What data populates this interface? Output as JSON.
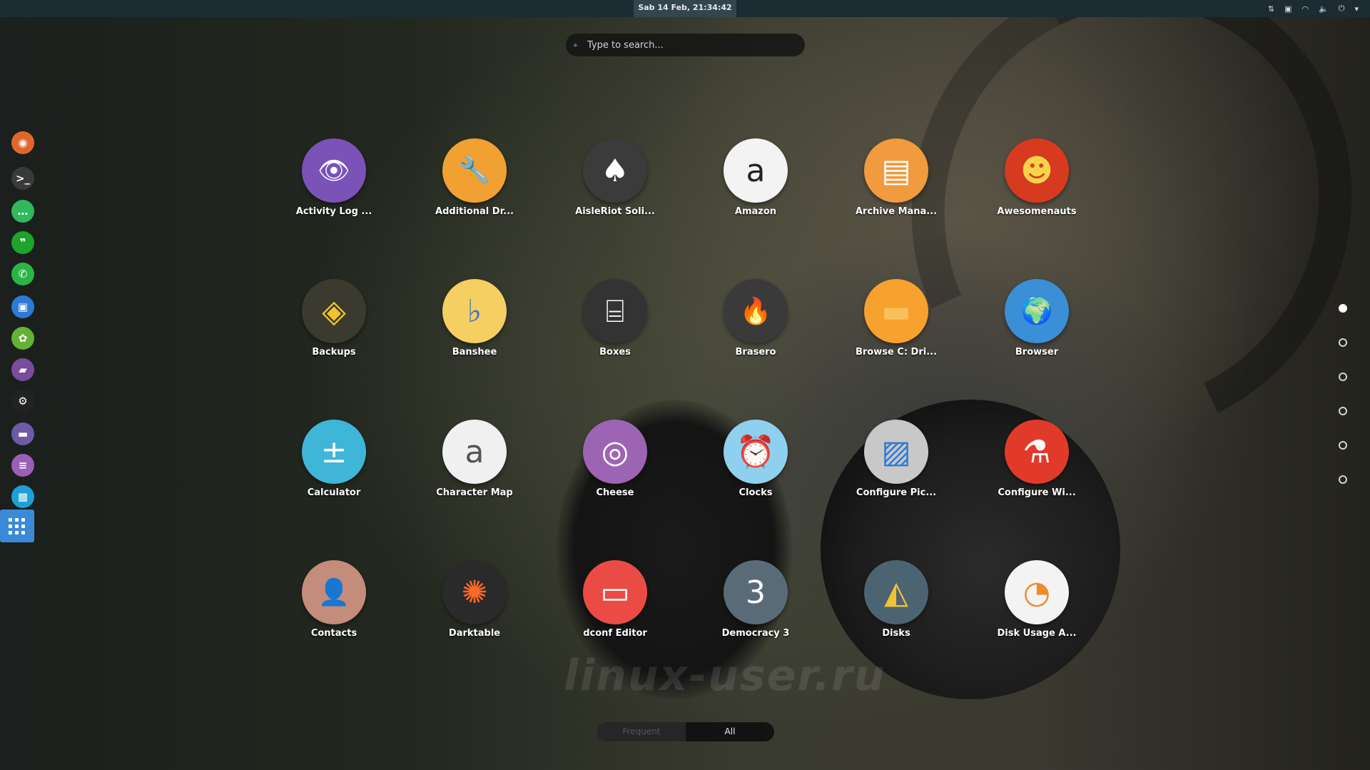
{
  "topbar": {
    "clock": "Sab 14 Feb, 21:34:42"
  },
  "search": {
    "placeholder": "Type to search..."
  },
  "dock": {
    "items": [
      {
        "name": "firefox",
        "color": "#e0672c",
        "glyph": "◉"
      },
      {
        "name": "terminal",
        "color": "#3a3a3a",
        "glyph": ">_"
      },
      {
        "name": "chat",
        "color": "#2fb95a",
        "glyph": "…"
      },
      {
        "name": "hangouts",
        "color": "#1ea32b",
        "glyph": "❞"
      },
      {
        "name": "whatsapp",
        "color": "#2bb544",
        "glyph": "✆"
      },
      {
        "name": "viewer",
        "color": "#2d7ad6",
        "glyph": "▣"
      },
      {
        "name": "app-green",
        "color": "#62b234",
        "glyph": "✿"
      },
      {
        "name": "app-purple-yellow",
        "color": "#7a4c9b",
        "glyph": "▰"
      },
      {
        "name": "steam",
        "color": "#222222",
        "glyph": "⚙"
      },
      {
        "name": "files",
        "color": "#6f5aa8",
        "glyph": "▬"
      },
      {
        "name": "document",
        "color": "#9b5fb5",
        "glyph": "≡"
      },
      {
        "name": "monitor",
        "color": "#1f9fd8",
        "glyph": "▦"
      },
      {
        "name": "kodi",
        "color": "#3d4e5c",
        "glyph": "◆"
      }
    ]
  },
  "apps": [
    {
      "label": "Activity Log ...",
      "icon": "eye-icon",
      "bg": "#7a52b8",
      "glyph": "👁",
      "fg": "#ffffff"
    },
    {
      "label": "Additional Dr...",
      "icon": "wrench-icon",
      "bg": "#f1a132",
      "glyph": "🔧",
      "fg": "#3a2a10"
    },
    {
      "label": "AisleRiot Soli...",
      "icon": "cards-icon",
      "bg": "#3b3b3b",
      "glyph": "♠",
      "fg": "#ffffff"
    },
    {
      "label": "Amazon",
      "icon": "amazon-icon",
      "bg": "#f3f3f3",
      "glyph": "a",
      "fg": "#222222"
    },
    {
      "label": "Archive Mana...",
      "icon": "archive-icon",
      "bg": "#f19a3e",
      "glyph": "▤",
      "fg": "#ffffff"
    },
    {
      "label": "Awesomenauts",
      "icon": "awesomenauts-icon",
      "bg": "#d73a1f",
      "glyph": "☻",
      "fg": "#f7d34a"
    },
    {
      "label": "Backups",
      "icon": "backups-icon",
      "bg": "#3a3a2e",
      "glyph": "◈",
      "fg": "#f1c232"
    },
    {
      "label": "Banshee",
      "icon": "banshee-icon",
      "bg": "#f5cf62",
      "glyph": "♭",
      "fg": "#3d73c8"
    },
    {
      "label": "Boxes",
      "icon": "boxes-icon",
      "bg": "#333333",
      "glyph": "⌸",
      "fg": "#ffffff"
    },
    {
      "label": "Brasero",
      "icon": "brasero-icon",
      "bg": "#3a3a3a",
      "glyph": "🔥",
      "fg": "#f6a21f"
    },
    {
      "label": "Browse C: Dri...",
      "icon": "folder-icon",
      "bg": "#f7a12f",
      "glyph": "▬",
      "fg": "#f7c05a"
    },
    {
      "label": "Browser",
      "icon": "globe-icon",
      "bg": "#3a8fd6",
      "glyph": "🌍",
      "fg": "#ffffff"
    },
    {
      "label": "Calculator",
      "icon": "calculator-icon",
      "bg": "#3fb6d8",
      "glyph": "±",
      "fg": "#ffffff"
    },
    {
      "label": "Character Map",
      "icon": "charmap-icon",
      "bg": "#f0f0f0",
      "glyph": "a",
      "fg": "#555555"
    },
    {
      "label": "Cheese",
      "icon": "webcam-icon",
      "bg": "#9d64b4",
      "glyph": "◎",
      "fg": "#ffffff"
    },
    {
      "label": "Clocks",
      "icon": "clock-icon",
      "bg": "#8fd0ee",
      "glyph": "⏰",
      "fg": "#ffffff"
    },
    {
      "label": "Configure Pic...",
      "icon": "picture-icon",
      "bg": "#c8c8c8",
      "glyph": "▨",
      "fg": "#2d7ad6"
    },
    {
      "label": "Configure Wi...",
      "icon": "wine-icon",
      "bg": "#e23a2a",
      "glyph": "⚗",
      "fg": "#ffffff"
    },
    {
      "label": "Contacts",
      "icon": "contacts-icon",
      "bg": "#c48c7a",
      "glyph": "👤",
      "fg": "#ffffff"
    },
    {
      "label": "Darktable",
      "icon": "darktable-icon",
      "bg": "#2a2a2a",
      "glyph": "✺",
      "fg": "#ff6a2a"
    },
    {
      "label": "dconf Editor",
      "icon": "dconf-icon",
      "bg": "#ea4c45",
      "glyph": "▭",
      "fg": "#ffffff"
    },
    {
      "label": "Democracy 3",
      "icon": "democracy-icon",
      "bg": "#5a6b78",
      "glyph": "3",
      "fg": "#ffffff"
    },
    {
      "label": "Disks",
      "icon": "disks-icon",
      "bg": "#4c6472",
      "glyph": "◭",
      "fg": "#f1c232"
    },
    {
      "label": "Disk Usage A...",
      "icon": "disk-usage-icon",
      "bg": "#f3f3f3",
      "glyph": "◔",
      "fg": "#f08a2a"
    }
  ],
  "pages": {
    "count": 6,
    "active": 0
  },
  "switch": {
    "frequent": "Frequent",
    "all": "All",
    "selected": "All"
  },
  "watermark": "linux-user.ru"
}
